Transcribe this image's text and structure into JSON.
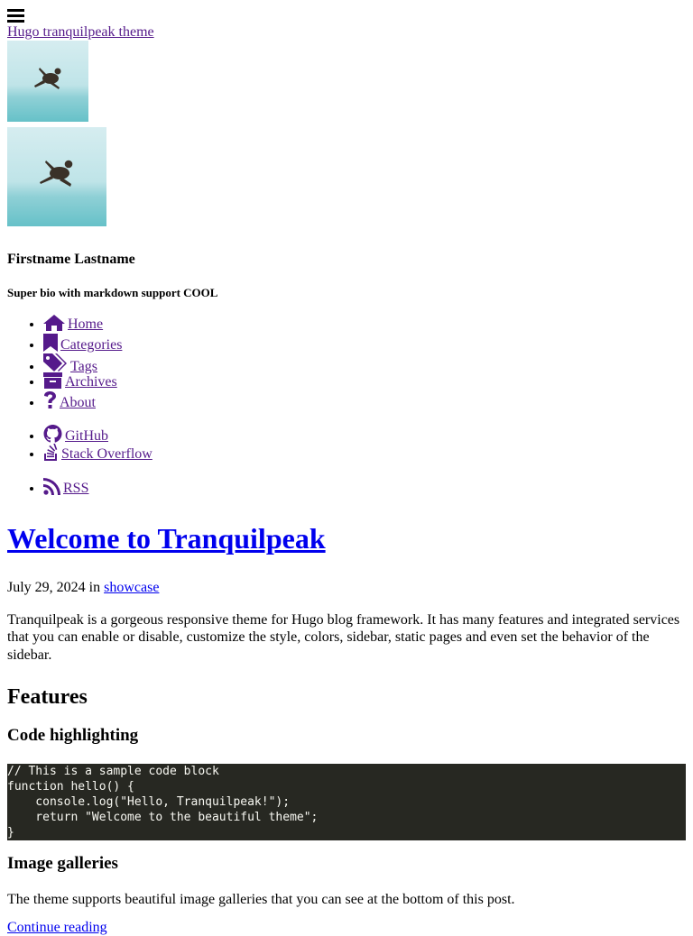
{
  "header": {
    "menu_icon": "hamburger-menu-icon",
    "blog_title": "Hugo tranquilpeak theme"
  },
  "profile": {
    "name": "Firstname Lastname",
    "bio": "Super bio with markdown support COOL",
    "avatar_icon": "person-jumping-photo"
  },
  "nav": {
    "main": [
      {
        "label": "Home",
        "icon": "home-icon"
      },
      {
        "label": "Categories",
        "icon": "bookmark-icon"
      },
      {
        "label": "Tags",
        "icon": "tags-icon"
      },
      {
        "label": "Archives",
        "icon": "archive-icon"
      },
      {
        "label": "About",
        "icon": "question-icon"
      }
    ],
    "social": [
      {
        "label": "GitHub",
        "icon": "github-icon"
      },
      {
        "label": "Stack Overflow",
        "icon": "stack-overflow-icon"
      }
    ],
    "feeds": [
      {
        "label": "RSS",
        "icon": "rss-icon"
      }
    ]
  },
  "post": {
    "title": "Welcome to Tranquilpeak",
    "date": "July 29, 2024",
    "in_label": "in",
    "category": "showcase",
    "intro": "Tranquilpeak is a gorgeous responsive theme for Hugo blog framework. It has many features and integrated services that you can enable or disable, customize the style, colors, sidebar, static pages and even set the behavior of the sidebar.",
    "features_heading": "Features",
    "code_heading": "Code highlighting",
    "code": "// This is a sample code block\nfunction hello() {\n    console.log(\"Hello, Tranquilpeak!\");\n    return \"Welcome to the beautiful theme\";\n}",
    "gallery_heading": "Image galleries",
    "gallery_text": "The theme supports beautiful image galleries that you can see at the bottom of this post.",
    "continue_label": "Continue reading"
  }
}
